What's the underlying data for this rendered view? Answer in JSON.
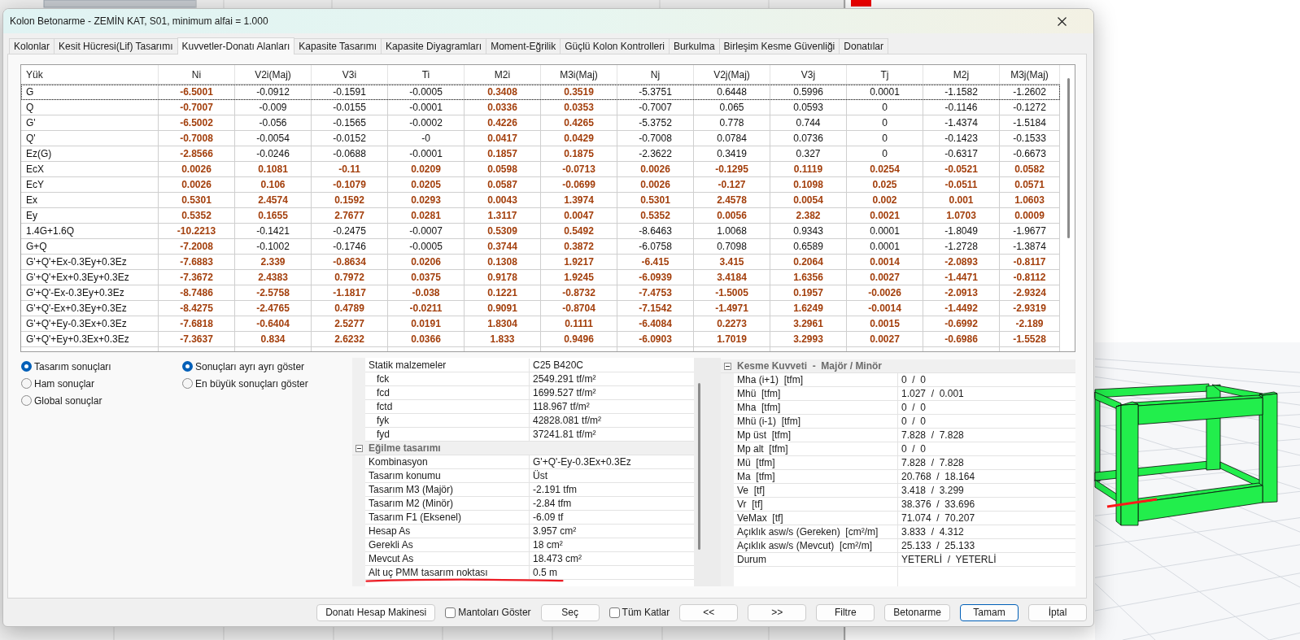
{
  "window": {
    "title": "Kolon Betonarme - ZEMİN KAT, S01, minimum alfai = 1.000"
  },
  "tabs": [
    {
      "label": "Kolonlar",
      "selected": false
    },
    {
      "label": "Kesit Hücresi(Lif) Tasarımı",
      "selected": false
    },
    {
      "label": "Kuvvetler-Donatı Alanları",
      "selected": true
    },
    {
      "label": "Kapasite Tasarımı",
      "selected": false
    },
    {
      "label": "Kapasite Diyagramları",
      "selected": false
    },
    {
      "label": "Moment-Eğrilik",
      "selected": false
    },
    {
      "label": "Güçlü Kolon Kontrolleri",
      "selected": false
    },
    {
      "label": "Burkulma",
      "selected": false
    },
    {
      "label": "Birleşim Kesme Güvenliği",
      "selected": false
    },
    {
      "label": "Donatılar",
      "selected": false
    }
  ],
  "table": {
    "columns": [
      "Yük",
      "Ni",
      "V2i(Maj)",
      "V3i",
      "Ti",
      "M2i",
      "M3i(Maj)",
      "Nj",
      "V2j(Maj)",
      "V3j",
      "Tj",
      "M2j",
      "M3j(Maj)"
    ],
    "rows": [
      {
        "selected": true,
        "cells": [
          {
            "value": "G",
            "highlighted": false
          },
          {
            "value": "-6.5001",
            "highlighted": true
          },
          {
            "value": "-0.0912",
            "highlighted": false
          },
          {
            "value": "-0.1591",
            "highlighted": false
          },
          {
            "value": "-0.0005",
            "highlighted": false
          },
          {
            "value": "0.3408",
            "highlighted": true
          },
          {
            "value": "0.3519",
            "highlighted": true
          },
          {
            "value": "-5.3751",
            "highlighted": false
          },
          {
            "value": "0.6448",
            "highlighted": false
          },
          {
            "value": "0.5996",
            "highlighted": false
          },
          {
            "value": "0.0001",
            "highlighted": false
          },
          {
            "value": "-1.1582",
            "highlighted": false
          },
          {
            "value": "-1.2602",
            "highlighted": false
          }
        ]
      },
      {
        "selected": false,
        "cells": [
          {
            "value": "Q",
            "highlighted": false
          },
          {
            "value": "-0.7007",
            "highlighted": true
          },
          {
            "value": "-0.009",
            "highlighted": false
          },
          {
            "value": "-0.0155",
            "highlighted": false
          },
          {
            "value": "-0.0001",
            "highlighted": false
          },
          {
            "value": "0.0336",
            "highlighted": true
          },
          {
            "value": "0.0353",
            "highlighted": true
          },
          {
            "value": "-0.7007",
            "highlighted": false
          },
          {
            "value": "0.065",
            "highlighted": false
          },
          {
            "value": "0.0593",
            "highlighted": false
          },
          {
            "value": "0",
            "highlighted": false
          },
          {
            "value": "-0.1146",
            "highlighted": false
          },
          {
            "value": "-0.1272",
            "highlighted": false
          }
        ]
      },
      {
        "selected": false,
        "cells": [
          {
            "value": "G'",
            "highlighted": false
          },
          {
            "value": "-6.5002",
            "highlighted": true
          },
          {
            "value": "-0.056",
            "highlighted": false
          },
          {
            "value": "-0.1565",
            "highlighted": false
          },
          {
            "value": "-0.0002",
            "highlighted": false
          },
          {
            "value": "0.4226",
            "highlighted": true
          },
          {
            "value": "0.4265",
            "highlighted": true
          },
          {
            "value": "-5.3752",
            "highlighted": false
          },
          {
            "value": "0.778",
            "highlighted": false
          },
          {
            "value": "0.744",
            "highlighted": false
          },
          {
            "value": "0",
            "highlighted": false
          },
          {
            "value": "-1.4374",
            "highlighted": false
          },
          {
            "value": "-1.5184",
            "highlighted": false
          }
        ]
      },
      {
        "selected": false,
        "cells": [
          {
            "value": "Q'",
            "highlighted": false
          },
          {
            "value": "-0.7008",
            "highlighted": true
          },
          {
            "value": "-0.0054",
            "highlighted": false
          },
          {
            "value": "-0.0152",
            "highlighted": false
          },
          {
            "value": "-0",
            "highlighted": false
          },
          {
            "value": "0.0417",
            "highlighted": true
          },
          {
            "value": "0.0429",
            "highlighted": true
          },
          {
            "value": "-0.7008",
            "highlighted": false
          },
          {
            "value": "0.0784",
            "highlighted": false
          },
          {
            "value": "0.0736",
            "highlighted": false
          },
          {
            "value": "0",
            "highlighted": false
          },
          {
            "value": "-0.1423",
            "highlighted": false
          },
          {
            "value": "-0.1533",
            "highlighted": false
          }
        ]
      },
      {
        "selected": false,
        "cells": [
          {
            "value": "Ez(G)",
            "highlighted": false
          },
          {
            "value": "-2.8566",
            "highlighted": true
          },
          {
            "value": "-0.0246",
            "highlighted": false
          },
          {
            "value": "-0.0688",
            "highlighted": false
          },
          {
            "value": "-0.0001",
            "highlighted": false
          },
          {
            "value": "0.1857",
            "highlighted": true
          },
          {
            "value": "0.1875",
            "highlighted": true
          },
          {
            "value": "-2.3622",
            "highlighted": false
          },
          {
            "value": "0.3419",
            "highlighted": false
          },
          {
            "value": "0.327",
            "highlighted": false
          },
          {
            "value": "0",
            "highlighted": false
          },
          {
            "value": "-0.6317",
            "highlighted": false
          },
          {
            "value": "-0.6673",
            "highlighted": false
          }
        ]
      },
      {
        "selected": false,
        "cells": [
          {
            "value": "EcX",
            "highlighted": false
          },
          {
            "value": "0.0026",
            "highlighted": true
          },
          {
            "value": "0.1081",
            "highlighted": true
          },
          {
            "value": "-0.11",
            "highlighted": true
          },
          {
            "value": "0.0209",
            "highlighted": true
          },
          {
            "value": "0.0598",
            "highlighted": true
          },
          {
            "value": "-0.0713",
            "highlighted": true
          },
          {
            "value": "0.0026",
            "highlighted": true
          },
          {
            "value": "-0.1295",
            "highlighted": true
          },
          {
            "value": "0.1119",
            "highlighted": true
          },
          {
            "value": "0.0254",
            "highlighted": true
          },
          {
            "value": "-0.0521",
            "highlighted": true
          },
          {
            "value": "0.0582",
            "highlighted": true
          }
        ]
      },
      {
        "selected": false,
        "cells": [
          {
            "value": "EcY",
            "highlighted": false
          },
          {
            "value": "0.0026",
            "highlighted": true
          },
          {
            "value": "0.106",
            "highlighted": true
          },
          {
            "value": "-0.1079",
            "highlighted": true
          },
          {
            "value": "0.0205",
            "highlighted": true
          },
          {
            "value": "0.0587",
            "highlighted": true
          },
          {
            "value": "-0.0699",
            "highlighted": true
          },
          {
            "value": "0.0026",
            "highlighted": true
          },
          {
            "value": "-0.127",
            "highlighted": true
          },
          {
            "value": "0.1098",
            "highlighted": true
          },
          {
            "value": "0.025",
            "highlighted": true
          },
          {
            "value": "-0.0511",
            "highlighted": true
          },
          {
            "value": "0.0571",
            "highlighted": true
          }
        ]
      },
      {
        "selected": false,
        "cells": [
          {
            "value": "Ex",
            "highlighted": false
          },
          {
            "value": "0.5301",
            "highlighted": true
          },
          {
            "value": "2.4574",
            "highlighted": true
          },
          {
            "value": "0.1592",
            "highlighted": true
          },
          {
            "value": "0.0293",
            "highlighted": true
          },
          {
            "value": "0.0043",
            "highlighted": true
          },
          {
            "value": "1.3974",
            "highlighted": true
          },
          {
            "value": "0.5301",
            "highlighted": true
          },
          {
            "value": "2.4578",
            "highlighted": true
          },
          {
            "value": "0.0054",
            "highlighted": true
          },
          {
            "value": "0.002",
            "highlighted": true
          },
          {
            "value": "0.001",
            "highlighted": true
          },
          {
            "value": "1.0603",
            "highlighted": true
          }
        ]
      },
      {
        "selected": false,
        "cells": [
          {
            "value": "Ey",
            "highlighted": false
          },
          {
            "value": "0.5352",
            "highlighted": true
          },
          {
            "value": "0.1655",
            "highlighted": true
          },
          {
            "value": "2.7677",
            "highlighted": true
          },
          {
            "value": "0.0281",
            "highlighted": true
          },
          {
            "value": "1.3117",
            "highlighted": true
          },
          {
            "value": "0.0047",
            "highlighted": true
          },
          {
            "value": "0.5352",
            "highlighted": true
          },
          {
            "value": "0.0056",
            "highlighted": true
          },
          {
            "value": "2.382",
            "highlighted": true
          },
          {
            "value": "0.0021",
            "highlighted": true
          },
          {
            "value": "1.0703",
            "highlighted": true
          },
          {
            "value": "0.0009",
            "highlighted": true
          }
        ]
      },
      {
        "selected": false,
        "cells": [
          {
            "value": "1.4G+1.6Q",
            "highlighted": false
          },
          {
            "value": "-10.2213",
            "highlighted": true
          },
          {
            "value": "-0.1421",
            "highlighted": false
          },
          {
            "value": "-0.2475",
            "highlighted": false
          },
          {
            "value": "-0.0007",
            "highlighted": false
          },
          {
            "value": "0.5309",
            "highlighted": true
          },
          {
            "value": "0.5492",
            "highlighted": true
          },
          {
            "value": "-8.6463",
            "highlighted": false
          },
          {
            "value": "1.0068",
            "highlighted": false
          },
          {
            "value": "0.9343",
            "highlighted": false
          },
          {
            "value": "0.0001",
            "highlighted": false
          },
          {
            "value": "-1.8049",
            "highlighted": false
          },
          {
            "value": "-1.9677",
            "highlighted": false
          }
        ]
      },
      {
        "selected": false,
        "cells": [
          {
            "value": "G+Q",
            "highlighted": false
          },
          {
            "value": "-7.2008",
            "highlighted": true
          },
          {
            "value": "-0.1002",
            "highlighted": false
          },
          {
            "value": "-0.1746",
            "highlighted": false
          },
          {
            "value": "-0.0005",
            "highlighted": false
          },
          {
            "value": "0.3744",
            "highlighted": true
          },
          {
            "value": "0.3872",
            "highlighted": true
          },
          {
            "value": "-6.0758",
            "highlighted": false
          },
          {
            "value": "0.7098",
            "highlighted": false
          },
          {
            "value": "0.6589",
            "highlighted": false
          },
          {
            "value": "0.0001",
            "highlighted": false
          },
          {
            "value": "-1.2728",
            "highlighted": false
          },
          {
            "value": "-1.3874",
            "highlighted": false
          }
        ]
      },
      {
        "selected": false,
        "cells": [
          {
            "value": "G'+Q'+Ex-0.3Ey+0.3Ez",
            "highlighted": false
          },
          {
            "value": "-7.6883",
            "highlighted": true
          },
          {
            "value": "2.339",
            "highlighted": true
          },
          {
            "value": "-0.8634",
            "highlighted": true
          },
          {
            "value": "0.0206",
            "highlighted": true
          },
          {
            "value": "0.1308",
            "highlighted": true
          },
          {
            "value": "1.9217",
            "highlighted": true
          },
          {
            "value": "-6.415",
            "highlighted": true
          },
          {
            "value": "3.415",
            "highlighted": true
          },
          {
            "value": "0.2064",
            "highlighted": true
          },
          {
            "value": "0.0014",
            "highlighted": true
          },
          {
            "value": "-2.0893",
            "highlighted": true
          },
          {
            "value": "-0.8117",
            "highlighted": true
          }
        ]
      },
      {
        "selected": false,
        "cells": [
          {
            "value": "G'+Q'+Ex+0.3Ey+0.3Ez",
            "highlighted": false
          },
          {
            "value": "-7.3672",
            "highlighted": true
          },
          {
            "value": "2.4383",
            "highlighted": true
          },
          {
            "value": "0.7972",
            "highlighted": true
          },
          {
            "value": "0.0375",
            "highlighted": true
          },
          {
            "value": "0.9178",
            "highlighted": true
          },
          {
            "value": "1.9245",
            "highlighted": true
          },
          {
            "value": "-6.0939",
            "highlighted": true
          },
          {
            "value": "3.4184",
            "highlighted": true
          },
          {
            "value": "1.6356",
            "highlighted": true
          },
          {
            "value": "0.0027",
            "highlighted": true
          },
          {
            "value": "-1.4471",
            "highlighted": true
          },
          {
            "value": "-0.8112",
            "highlighted": true
          }
        ]
      },
      {
        "selected": false,
        "cells": [
          {
            "value": "G'+Q'-Ex-0.3Ey+0.3Ez",
            "highlighted": false
          },
          {
            "value": "-8.7486",
            "highlighted": true
          },
          {
            "value": "-2.5758",
            "highlighted": true
          },
          {
            "value": "-1.1817",
            "highlighted": true
          },
          {
            "value": "-0.038",
            "highlighted": true
          },
          {
            "value": "0.1221",
            "highlighted": true
          },
          {
            "value": "-0.8732",
            "highlighted": true
          },
          {
            "value": "-7.4753",
            "highlighted": true
          },
          {
            "value": "-1.5005",
            "highlighted": true
          },
          {
            "value": "0.1957",
            "highlighted": true
          },
          {
            "value": "-0.0026",
            "highlighted": true
          },
          {
            "value": "-2.0913",
            "highlighted": true
          },
          {
            "value": "-2.9324",
            "highlighted": true
          }
        ]
      },
      {
        "selected": false,
        "cells": [
          {
            "value": "G'+Q'-Ex+0.3Ey+0.3Ez",
            "highlighted": false
          },
          {
            "value": "-8.4275",
            "highlighted": true
          },
          {
            "value": "-2.4765",
            "highlighted": true
          },
          {
            "value": "0.4789",
            "highlighted": true
          },
          {
            "value": "-0.0211",
            "highlighted": true
          },
          {
            "value": "0.9091",
            "highlighted": true
          },
          {
            "value": "-0.8704",
            "highlighted": true
          },
          {
            "value": "-7.1542",
            "highlighted": true
          },
          {
            "value": "-1.4971",
            "highlighted": true
          },
          {
            "value": "1.6249",
            "highlighted": true
          },
          {
            "value": "-0.0014",
            "highlighted": true
          },
          {
            "value": "-1.4492",
            "highlighted": true
          },
          {
            "value": "-2.9319",
            "highlighted": true
          }
        ]
      },
      {
        "selected": false,
        "cells": [
          {
            "value": "G'+Q'+Ey-0.3Ex+0.3Ez",
            "highlighted": false
          },
          {
            "value": "-7.6818",
            "highlighted": true
          },
          {
            "value": "-0.6404",
            "highlighted": true
          },
          {
            "value": "2.5277",
            "highlighted": true
          },
          {
            "value": "0.0191",
            "highlighted": true
          },
          {
            "value": "1.8304",
            "highlighted": true
          },
          {
            "value": "0.1111",
            "highlighted": true
          },
          {
            "value": "-6.4084",
            "highlighted": true
          },
          {
            "value": "0.2273",
            "highlighted": true
          },
          {
            "value": "3.2961",
            "highlighted": true
          },
          {
            "value": "0.0015",
            "highlighted": true
          },
          {
            "value": "-0.6992",
            "highlighted": true
          },
          {
            "value": "-2.189",
            "highlighted": true
          }
        ]
      },
      {
        "selected": false,
        "cells": [
          {
            "value": "G'+Q'+Ey+0.3Ex+0.3Ez",
            "highlighted": false
          },
          {
            "value": "-7.3637",
            "highlighted": true
          },
          {
            "value": "0.834",
            "highlighted": true
          },
          {
            "value": "2.6232",
            "highlighted": true
          },
          {
            "value": "0.0366",
            "highlighted": true
          },
          {
            "value": "1.833",
            "highlighted": true
          },
          {
            "value": "0.9496",
            "highlighted": true
          },
          {
            "value": "-6.0903",
            "highlighted": true
          },
          {
            "value": "1.7019",
            "highlighted": true
          },
          {
            "value": "3.2993",
            "highlighted": true
          },
          {
            "value": "0.0027",
            "highlighted": true
          },
          {
            "value": "-0.6986",
            "highlighted": true
          },
          {
            "value": "-1.5528",
            "highlighted": true
          }
        ]
      }
    ]
  },
  "result_options": [
    {
      "label": "Tasarım sonuçları",
      "selected": true
    },
    {
      "label": "Ham sonuçlar",
      "selected": false
    },
    {
      "label": "Global sonuçlar",
      "selected": false
    }
  ],
  "display_options": [
    {
      "label": "Sonuçları ayrı ayrı göster",
      "selected": true
    },
    {
      "label": "En büyük sonuçları göster",
      "selected": false
    }
  ],
  "design_properties": [
    {
      "kind": "property",
      "label": "Statik malzemeler",
      "value": "C25 B420C",
      "underlined": false,
      "children": [
        {
          "label": "fck",
          "value": "2549.291 tf/m²",
          "underlined": false
        },
        {
          "label": "fcd",
          "value": "1699.527 tf/m²",
          "underlined": false
        },
        {
          "label": "fctd",
          "value": "118.967 tf/m²",
          "underlined": false
        },
        {
          "label": "fyk",
          "value": "42828.081 tf/m²",
          "underlined": false
        },
        {
          "label": "fyd",
          "value": "37241.81 tf/m²",
          "underlined": false
        }
      ]
    },
    {
      "kind": "category",
      "label": "Eğilme tasarımı",
      "expanded": true,
      "children": [
        {
          "label": "Kombinasyon",
          "value": "G'+Q'-Ey-0.3Ex+0.3Ez",
          "underlined": false
        },
        {
          "label": "Tasarım konumu",
          "value": "Üst",
          "underlined": false
        },
        {
          "label": "Tasarım M3 (Majör)",
          "value": "-2.191 tfm",
          "underlined": false
        },
        {
          "label": "Tasarım M2 (Minör)",
          "value": "-2.84 tfm",
          "underlined": false
        },
        {
          "label": "Tasarım F1 (Eksenel)",
          "value": "-6.09 tf",
          "underlined": false
        },
        {
          "label": "Hesap As",
          "value": "3.957 cm²",
          "underlined": false
        },
        {
          "label": "Gerekli As",
          "value": "18 cm²",
          "underlined": false
        },
        {
          "label": "Mevcut As",
          "value": "18.473 cm²",
          "underlined": false
        },
        {
          "label": "Alt uç PMM tasarım noktası",
          "value": "0.5 m",
          "underlined": true
        }
      ]
    }
  ],
  "shear_properties": [
    {
      "kind": "category",
      "label": "Kesme Kuvveti  -  Majör / Minör",
      "expanded": true,
      "children": [
        {
          "label": "Mha (i+1)  [tfm]",
          "value": "0  /  0"
        },
        {
          "label": "Mhü  [tfm]",
          "value": "1.027  /  0.001"
        },
        {
          "label": "Mha  [tfm]",
          "value": "0  /  0"
        },
        {
          "label": "Mhü (i-1)  [tfm]",
          "value": "0  /  0"
        },
        {
          "label": "Mp üst  [tfm]",
          "value": "7.828  /  7.828"
        },
        {
          "label": "Mp alt  [tfm]",
          "value": "0  /  0"
        },
        {
          "label": "Mü  [tfm]",
          "value": "7.828  /  7.828"
        },
        {
          "label": "Ma  [tfm]",
          "value": "20.768  /  18.164"
        },
        {
          "label": "Ve  [tf]",
          "value": "3.418  /  3.299"
        },
        {
          "label": "Vr  [tf]",
          "value": "38.376  /  33.696"
        },
        {
          "label": "VeMax  [tf]",
          "value": "71.074  /  70.207"
        },
        {
          "label": "Açıklık asw/s (Gereken)  [cm²/m]",
          "value": "3.833  /  4.312"
        },
        {
          "label": "Açıklık asw/s (Mevcut)  [cm²/m]",
          "value": "25.133  /  25.133"
        },
        {
          "label": "Durum",
          "value": "YETERLİ  /  YETERLİ"
        }
      ]
    }
  ],
  "footer": [
    {
      "kind": "button",
      "label": "Donatı Hesap Makinesi",
      "default": false
    },
    {
      "kind": "checkbox",
      "label": "Mantoları Göster",
      "checked": false
    },
    {
      "kind": "button",
      "label": "Seç",
      "default": false
    },
    {
      "kind": "checkbox",
      "label": "Tüm Katlar",
      "checked": false
    },
    {
      "kind": "button",
      "label": "<<",
      "default": false
    },
    {
      "kind": "button",
      "label": ">>",
      "default": false
    },
    {
      "kind": "button",
      "label": "Filtre",
      "default": false
    },
    {
      "kind": "button",
      "label": "Betonarme",
      "default": false
    },
    {
      "kind": "button",
      "label": "Tamam",
      "default": true
    },
    {
      "kind": "button",
      "label": "İptal",
      "default": false
    }
  ]
}
